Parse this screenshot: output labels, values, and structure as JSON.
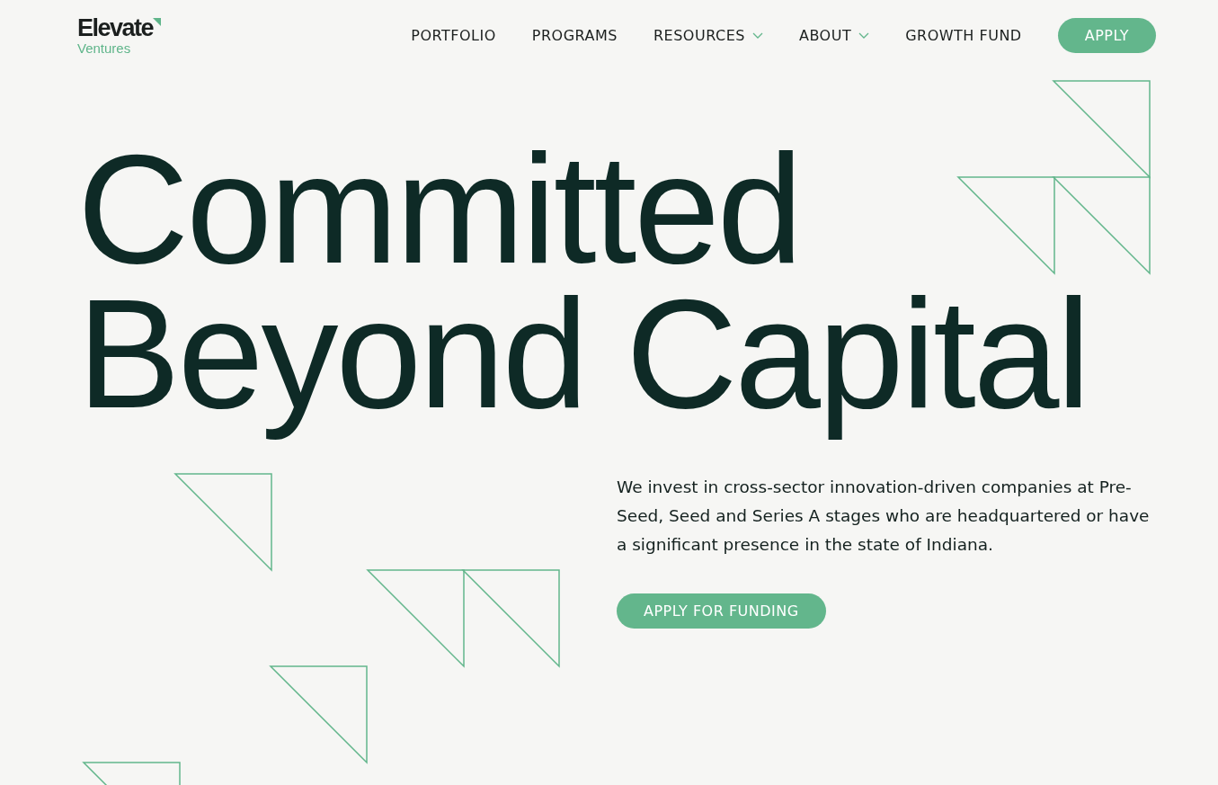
{
  "logo": {
    "wordmark": "Elevate",
    "subtitle": "Ventures"
  },
  "nav": [
    {
      "label": "PORTFOLIO",
      "dropdown": false
    },
    {
      "label": "PROGRAMS",
      "dropdown": false
    },
    {
      "label": "RESOURCES",
      "dropdown": true
    },
    {
      "label": "ABOUT",
      "dropdown": true
    },
    {
      "label": "GROWTH FUND",
      "dropdown": false
    }
  ],
  "apply_button": "APPLY",
  "headline": [
    "Committed",
    "Beyond Capital"
  ],
  "intro": "We invest in cross-sector innovation-driven companies at Pre-Seed, Seed and Series A stages who are headquartered or have a significant presence in the state of Indiana.",
  "cta_button": "APPLY FOR FUNDING"
}
